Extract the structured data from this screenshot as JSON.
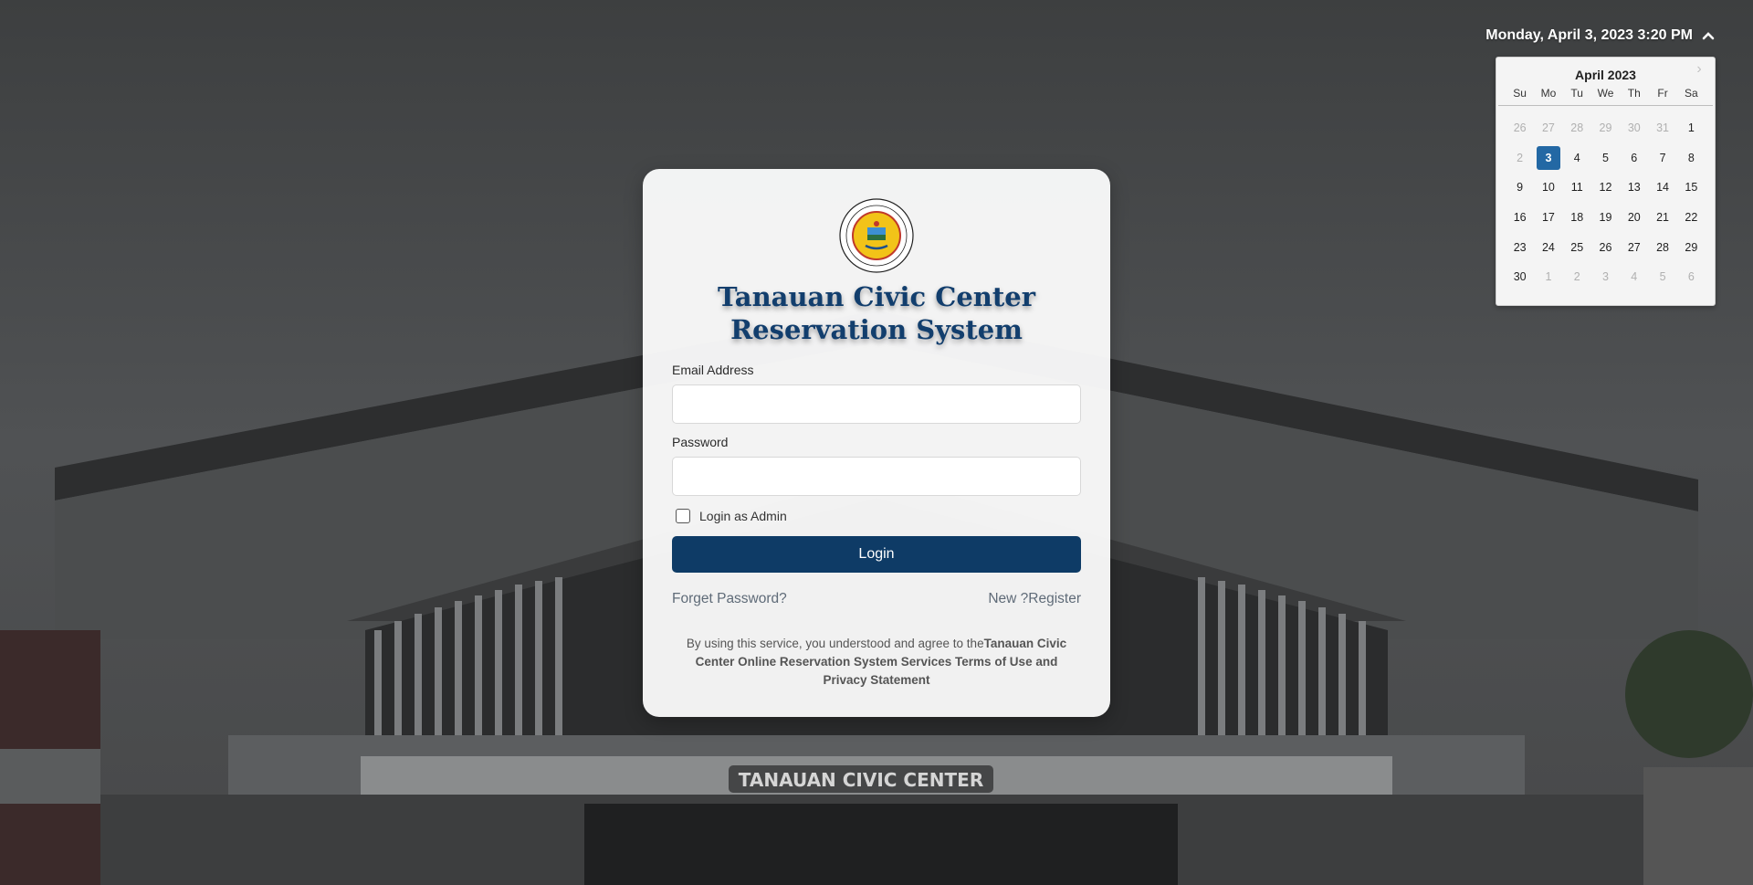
{
  "header": {
    "datetime": "Monday, April 3, 2023 3:20 PM"
  },
  "calendar": {
    "title": "April 2023",
    "weekdays": [
      "Su",
      "Mo",
      "Tu",
      "We",
      "Th",
      "Fr",
      "Sa"
    ],
    "weeks": [
      [
        "26",
        "27",
        "28",
        "29",
        "30",
        "31",
        "1"
      ],
      [
        "2",
        "3",
        "4",
        "5",
        "6",
        "7",
        "8"
      ],
      [
        "9",
        "10",
        "11",
        "12",
        "13",
        "14",
        "15"
      ],
      [
        "16",
        "17",
        "18",
        "19",
        "20",
        "21",
        "22"
      ],
      [
        "23",
        "24",
        "25",
        "26",
        "27",
        "28",
        "29"
      ],
      [
        "30",
        "1",
        "2",
        "3",
        "4",
        "5",
        "6"
      ]
    ],
    "selected": "3",
    "selected_color": "#2368a4"
  },
  "login": {
    "seal_icon": "municipal-seal-icon",
    "seal_text_top": "MUNICIPALITY OF TANAUAN, LEYTE",
    "seal_text_bottom": "OFFICIAL SEAL",
    "title_line1": "Tanauan Civic Center",
    "title_line2": "Reservation System",
    "email_label": "Email Address",
    "email_value": "",
    "password_label": "Password",
    "password_value": "",
    "admin_checkbox_label": "Login as Admin",
    "admin_checked": false,
    "login_button": "Login",
    "forgot_link": "Forget Password?",
    "register_link": "New ?Register",
    "terms_prefix": "By using this service, you understood and agree to the",
    "terms_bold": "Tanauan Civic Center Online Reservation System Services Terms of Use and Privacy Statement",
    "button_color": "#0e3b66",
    "title_color": "#123e6d"
  },
  "background": {
    "sign_text": "TANAUAN CIVIC CENTER"
  }
}
